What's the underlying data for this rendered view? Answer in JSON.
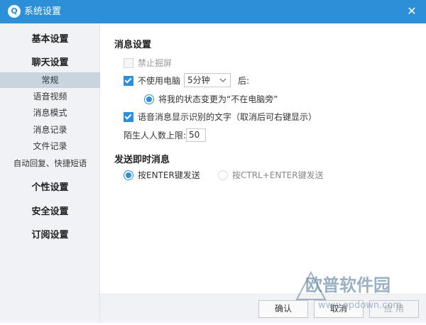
{
  "window": {
    "title": "系统设置",
    "close_glyph": "✕",
    "icon_glyph": "Q"
  },
  "sidebar": {
    "groups": [
      {
        "label": "基本设置"
      },
      {
        "label": "聊天设置"
      },
      {
        "label": "个性设置"
      },
      {
        "label": "安全设置"
      },
      {
        "label": "订阅设置"
      }
    ],
    "chat_items": [
      {
        "label": "常规",
        "active": true
      },
      {
        "label": "语音视频"
      },
      {
        "label": "消息模式"
      },
      {
        "label": "消息记录"
      },
      {
        "label": "文件记录"
      },
      {
        "label": "自动回复、快捷短语"
      }
    ]
  },
  "message_settings": {
    "title": "消息设置",
    "no_popup": {
      "label": "禁止掘屏",
      "checked": false,
      "disabled": true
    },
    "idle": {
      "label": "不使用电脑",
      "checked": true,
      "select_value": "5分钟",
      "suffix": "后:"
    },
    "away_status": {
      "label": "将我的状态变更为“不在电脑旁”",
      "selected": true
    },
    "voice_text": {
      "label": "语音消息显示识别的文字（取消后可右键显示）",
      "checked": true
    },
    "stranger_limit": {
      "label": "陌生人人数上限:",
      "value": "50"
    }
  },
  "send_settings": {
    "title": "发送即时消息",
    "options": [
      {
        "label": "按ENTER键发送",
        "selected": true
      },
      {
        "label": "按CTRL+ENTER键发送",
        "selected": false
      }
    ]
  },
  "buttons": {
    "ok": "确认",
    "cancel": "取消",
    "apply": "应 用"
  },
  "watermark": {
    "text": "欧普软件园",
    "url": "www.opdown.com"
  },
  "colors": {
    "accent": "#2c8fd8",
    "sidebar_bg": "#f0f2f5",
    "active_item": "#c9d4df"
  }
}
